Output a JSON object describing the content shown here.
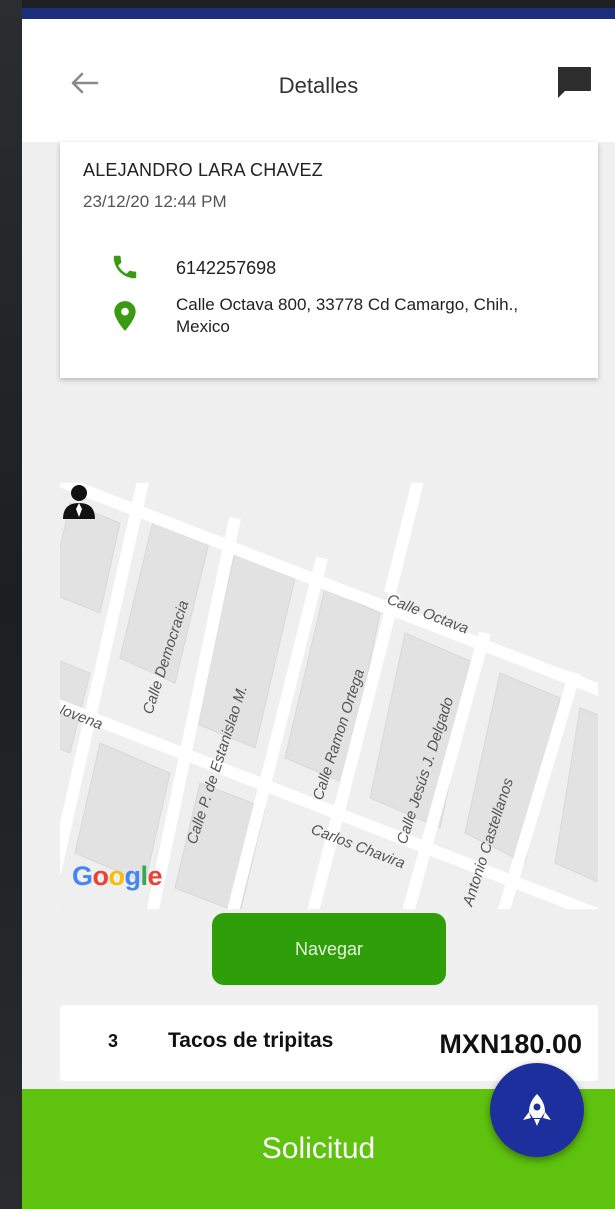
{
  "header": {
    "title": "Detalles",
    "back_icon": "arrow-left-icon",
    "chat_icon": "chat-bubble-icon"
  },
  "customer": {
    "name": "ALEJANDRO LARA CHAVEZ",
    "date": "23/12/20 12:44 PM",
    "phone": "6142257698",
    "address_line1": "Calle Octava 800, 33778 Cd Camargo, Chih.,",
    "address_line2": "Mexico"
  },
  "map": {
    "streets": [
      "Calle Octava",
      "Calle Democracia",
      "Calle P. de Estanislao M.",
      "Calle Ramon Ortega",
      "Calle Jesús J. Delgado",
      "Antonio Castellanos",
      "Carlos Chavira",
      "Novena"
    ],
    "provider": "Google"
  },
  "actions": {
    "navigate_label": "Navegar",
    "request_label": "Solicitud"
  },
  "order_item": {
    "qty": "3",
    "name": "Tacos de tripitas",
    "price": "MXN180.00"
  },
  "colors": {
    "primary_green": "#2e9e09",
    "bar_green": "#5ec20e",
    "icon_green": "#3c9a12",
    "fab_blue": "#1d2f9c",
    "status_blue": "#1a2e7a"
  }
}
